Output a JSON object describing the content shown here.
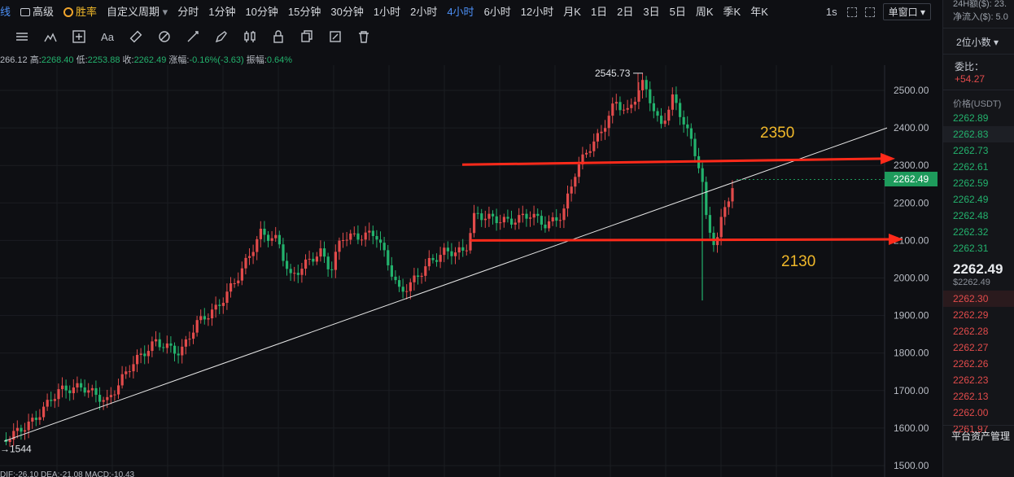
{
  "toolbar": {
    "items": [
      {
        "label": "线",
        "active": false
      },
      {
        "label": "高级",
        "active": false
      },
      {
        "label": "胜率",
        "active": false
      },
      {
        "label": "自定义周期",
        "active": false
      },
      {
        "label": "分时",
        "active": false
      },
      {
        "label": "1分钟",
        "active": false
      },
      {
        "label": "10分钟",
        "active": false
      },
      {
        "label": "15分钟",
        "active": false
      },
      {
        "label": "30分钟",
        "active": false
      },
      {
        "label": "1小时",
        "active": false
      },
      {
        "label": "2小时",
        "active": false
      },
      {
        "label": "4小时",
        "active": true
      },
      {
        "label": "6小时",
        "active": false
      },
      {
        "label": "12小时",
        "active": false
      },
      {
        "label": "月K",
        "active": false
      },
      {
        "label": "1日",
        "active": false
      },
      {
        "label": "2日",
        "active": false
      },
      {
        "label": "3日",
        "active": false
      },
      {
        "label": "5日",
        "active": false
      },
      {
        "label": "周K",
        "active": false
      },
      {
        "label": "季K",
        "active": false
      },
      {
        "label": "年K",
        "active": false
      }
    ],
    "interval_short": "1s",
    "window_select": "单窗口"
  },
  "ohlc": {
    "open": "266.12",
    "high_label": "高:",
    "high": "2268.40",
    "low_label": "低:",
    "low": "2253.88",
    "close_label": "收:",
    "close": "2262.49",
    "change_label": "涨幅:",
    "change": "-0.16%(-3.63)",
    "amp_label": "振幅:",
    "amp": "0.64%"
  },
  "chart_data": {
    "type": "candlestick",
    "y_axis_ticks": [
      "2500.00",
      "2400.00",
      "2300.00",
      "2200.00",
      "2100.00",
      "2000.00",
      "1900.00",
      "1800.00",
      "1700.00",
      "1600.00",
      "1500.00"
    ],
    "ylim": [
      1500,
      2600
    ],
    "current_price": "2262.49",
    "high_label": "2545.73",
    "low_label": "1544",
    "annotations": [
      {
        "text": "2350",
        "value": 2310
      },
      {
        "text": "2130",
        "value": 2105
      }
    ],
    "trendline": {
      "from": 1565,
      "to": 2400
    },
    "colors": {
      "up": "#23b26d",
      "down": "#e24b4b",
      "line": "#e8e8e8",
      "arrow": "#ff2a1a",
      "annot": "#f0b82a"
    }
  },
  "bottom_indicator": "DIF:-26.10  DEA:-21.08  MACD:-10.43",
  "right_panel": {
    "top_line1": "24H额($): 23.",
    "top_line2": "净流入($): 5.0",
    "decimal_select": "2位小数",
    "weibi_label": "委比：",
    "weibi_value": "+54.27",
    "price_header": "价格(USDT)",
    "asks": [
      "2262.89",
      "2262.83",
      "2262.73",
      "2262.61",
      "2262.59",
      "2262.49",
      "2262.48",
      "2262.32",
      "2262.31"
    ],
    "last_price": "2262.49",
    "last_price_usd": "$2262.49",
    "bids": [
      "2262.30",
      "2262.29",
      "2262.28",
      "2262.27",
      "2262.26",
      "2262.23",
      "2262.13",
      "2262.00",
      "2261.97"
    ],
    "footer": "平台资产管理"
  }
}
